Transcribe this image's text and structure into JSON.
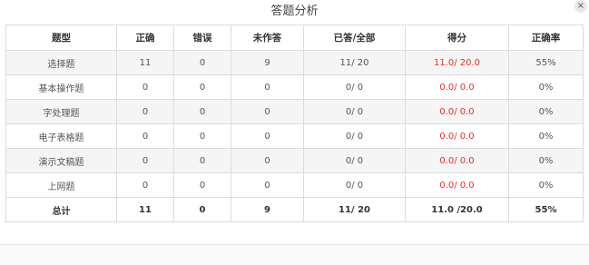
{
  "dialog": {
    "title": "答题分析",
    "close_label": "×"
  },
  "table": {
    "headers": [
      "题型",
      "正确",
      "错误",
      "未作答",
      "已答/全部",
      "得分",
      "正确率"
    ],
    "rows": [
      {
        "type": "选择题",
        "correct": "11",
        "wrong": "0",
        "unanswered": "9",
        "answered_total": "11/ 20",
        "score": "11.0/ 20.0",
        "accuracy": "55%"
      },
      {
        "type": "基本操作题",
        "correct": "0",
        "wrong": "0",
        "unanswered": "0",
        "answered_total": "0/ 0",
        "score": "0.0/ 0.0",
        "accuracy": "0%"
      },
      {
        "type": "字处理题",
        "correct": "0",
        "wrong": "0",
        "unanswered": "0",
        "answered_total": "0/ 0",
        "score": "0.0/ 0.0",
        "accuracy": "0%"
      },
      {
        "type": "电子表格题",
        "correct": "0",
        "wrong": "0",
        "unanswered": "0",
        "answered_total": "0/ 0",
        "score": "0.0/ 0.0",
        "accuracy": "0%"
      },
      {
        "type": "演示文稿题",
        "correct": "0",
        "wrong": "0",
        "unanswered": "0",
        "answered_total": "0/ 0",
        "score": "0.0/ 0.0",
        "accuracy": "0%"
      },
      {
        "type": "上网题",
        "correct": "0",
        "wrong": "0",
        "unanswered": "0",
        "answered_total": "0/ 0",
        "score": "0.0/ 0.0",
        "accuracy": "0%"
      }
    ],
    "total": {
      "type": "总计",
      "correct": "11",
      "wrong": "0",
      "unanswered": "9",
      "answered_total": "11/ 20",
      "score": "11.0 /20.0",
      "accuracy": "55%"
    }
  },
  "colors": {
    "score_text": "#e0302a",
    "border": "#dcdcdc",
    "stripe": "#f5f5f5"
  },
  "icons": {
    "close": "close-icon"
  }
}
